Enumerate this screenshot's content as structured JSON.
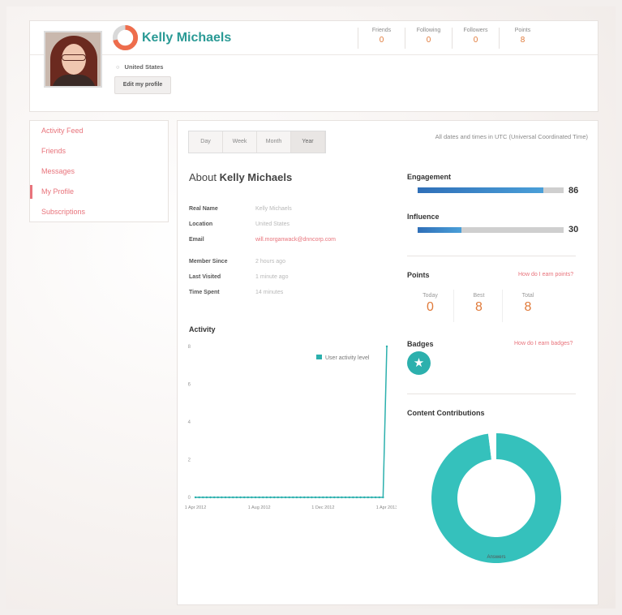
{
  "profile": {
    "name": "Kelly Michaels",
    "location": "United States",
    "edit_label": "Edit my profile"
  },
  "stats": [
    {
      "label": "Friends",
      "value": "0"
    },
    {
      "label": "Following",
      "value": "0"
    },
    {
      "label": "Followers",
      "value": "0"
    },
    {
      "label": "Points",
      "value": "8"
    }
  ],
  "sidebar": {
    "items": [
      {
        "label": "Activity Feed"
      },
      {
        "label": "Friends"
      },
      {
        "label": "Messages"
      },
      {
        "label": "My Profile"
      },
      {
        "label": "Subscriptions"
      }
    ]
  },
  "tabs": [
    {
      "label": "Day"
    },
    {
      "label": "Week"
    },
    {
      "label": "Month"
    },
    {
      "label": "Year"
    }
  ],
  "timezone_note": "All dates and times in UTC (Universal Coordinated Time)",
  "about": {
    "prefix": "About",
    "name": "Kelly Michaels",
    "rows": [
      {
        "key": "Real Name",
        "value": "Kelly Michaels"
      },
      {
        "key": "Location",
        "value": "United States"
      },
      {
        "key": "Email",
        "value": "will.morganwack@dnncorp.com"
      },
      {
        "key": "Member Since",
        "value": "2 hours ago"
      },
      {
        "key": "Last Visited",
        "value": "1 minute ago"
      },
      {
        "key": "Time Spent",
        "value": "14 minutes"
      }
    ]
  },
  "engagement": {
    "label": "Engagement",
    "value": 86
  },
  "influence": {
    "label": "Influence",
    "value": 30
  },
  "points": {
    "label": "Points",
    "help": "How do I earn points?",
    "boxes": [
      {
        "label": "Today",
        "value": "0"
      },
      {
        "label": "Best",
        "value": "8"
      },
      {
        "label": "Total",
        "value": "8"
      }
    ]
  },
  "badges": {
    "label": "Badges",
    "help": "How do I earn badges?",
    "icon": "star-icon"
  },
  "contributions": {
    "label": "Content Contributions"
  },
  "activity": {
    "label": "Activity"
  },
  "colors": {
    "accent": "#2cb0ad",
    "link": "#e8737b",
    "number": "#e07a3a"
  },
  "chart_data": [
    {
      "type": "line",
      "title": "Activity",
      "x": [
        "1 Apr 2012",
        "1 Aug 2012",
        "1 Dec 2012",
        "1 Apr 2013"
      ],
      "x_positions": [
        0,
        1,
        2,
        3
      ],
      "series": [
        {
          "name": "User activity level",
          "values": [
            0,
            0,
            0,
            0,
            0,
            0,
            0,
            0,
            0,
            0,
            0,
            0,
            0,
            0,
            0,
            0,
            0,
            0,
            0,
            0,
            0,
            0,
            0,
            0,
            0,
            0,
            0,
            0,
            0,
            0,
            0,
            0,
            0,
            0,
            0,
            0,
            0,
            0,
            0,
            0,
            0,
            0,
            0,
            0,
            0,
            0,
            0,
            0,
            0,
            0,
            0,
            8
          ]
        }
      ],
      "ytick_labels": [
        "0",
        "2",
        "4",
        "6",
        "8"
      ],
      "ylim": [
        0,
        8
      ],
      "legend": "top-right"
    },
    {
      "type": "pie",
      "title": "Content Contributions",
      "categories": [
        "Answers",
        "Other"
      ],
      "values": [
        98,
        2
      ],
      "slice_label": "Answers"
    }
  ]
}
